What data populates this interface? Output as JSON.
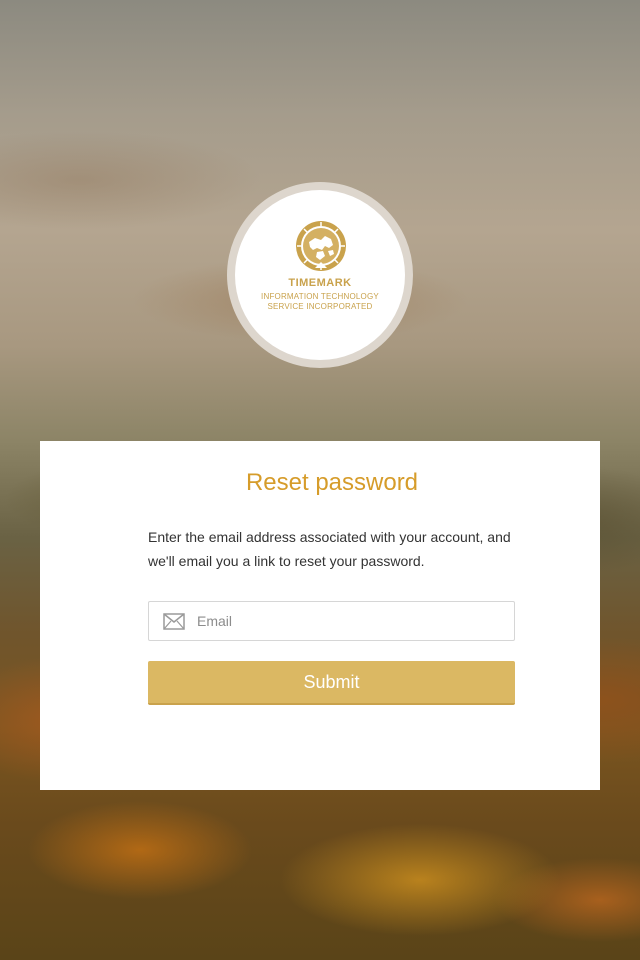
{
  "logo": {
    "icon": "globe-clock-emblem-icon",
    "name": "TIMEMARK",
    "subtitle_line1": "INFORMATION TECHNOLOGY",
    "subtitle_line2": "SERVICE INCORPORATED"
  },
  "card": {
    "title": "Reset password",
    "description": "Enter the email address associated with your account, and we'll email you a link to reset your password.",
    "email": {
      "icon": "envelope-icon",
      "value": "",
      "placeholder": "Email"
    },
    "submit_label": "Submit"
  },
  "colors": {
    "accent": "#d69c2a",
    "button": "#dbb863",
    "logo_gold": "#c9a24c"
  }
}
